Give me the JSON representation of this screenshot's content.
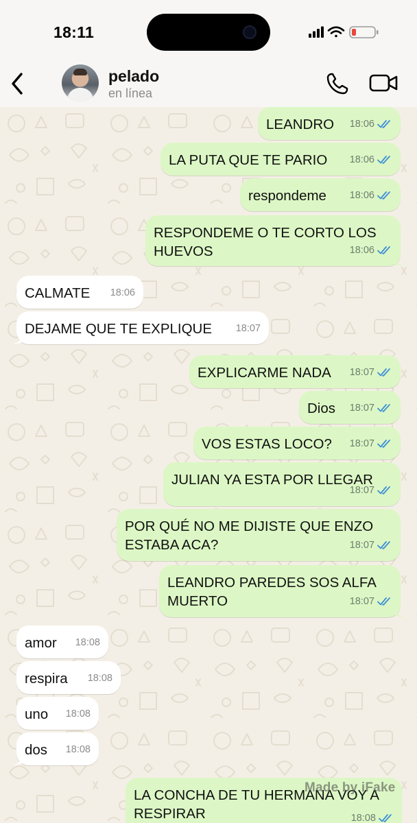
{
  "status_bar": {
    "time": "18:11"
  },
  "header": {
    "contact_name": "pelado",
    "contact_status": "en línea"
  },
  "messages": [
    {
      "dir": "out",
      "text": "LEANDRO",
      "time": "18:06"
    },
    {
      "dir": "out",
      "text": "LA PUTA QUE TE PARIO",
      "time": "18:06"
    },
    {
      "dir": "out",
      "text": "respondeme",
      "time": "18:06"
    },
    {
      "dir": "out",
      "text": "RESPONDEME O TE CORTO LOS HUEVOS",
      "time": "18:06"
    },
    {
      "dir": "in",
      "text": "CALMATE",
      "time": "18:06"
    },
    {
      "dir": "in",
      "text": "DEJAME QUE TE EXPLIQUE",
      "time": "18:07"
    },
    {
      "dir": "out",
      "text": "EXPLICARME NADA",
      "time": "18:07"
    },
    {
      "dir": "out",
      "text": "Dios",
      "time": "18:07"
    },
    {
      "dir": "out",
      "text": "VOS ESTAS LOCO?",
      "time": "18:07"
    },
    {
      "dir": "out",
      "text": "JULIAN YA ESTA POR LLEGAR",
      "time": "18:07"
    },
    {
      "dir": "out",
      "text": "POR QUÉ NO ME DIJISTE QUE ENZO ESTABA ACA?",
      "time": "18:07"
    },
    {
      "dir": "out",
      "text": "LEANDRO PAREDES SOS ALFA MUERTO",
      "time": "18:07"
    },
    {
      "dir": "in",
      "text": "amor",
      "time": "18:08"
    },
    {
      "dir": "in",
      "text": "respira",
      "time": "18:08"
    },
    {
      "dir": "in",
      "text": "uno",
      "time": "18:08"
    },
    {
      "dir": "in",
      "text": "dos",
      "time": "18:08"
    },
    {
      "dir": "out",
      "text": "LA CONCHA DE TU HERMANA VOY A RESPIRAR",
      "time": "18:08"
    }
  ],
  "watermark": "Made by iFake",
  "colors": {
    "outgoing_bubble": "#dcf7c5",
    "incoming_bubble": "#ffffff",
    "read_ticks": "#3f8fd6",
    "chat_background": "#f4efe6"
  },
  "icons": [
    "back-chevron-icon",
    "phone-icon",
    "video-camera-icon",
    "signal-icon",
    "wifi-icon",
    "battery-icon",
    "read-ticks-icon"
  ]
}
